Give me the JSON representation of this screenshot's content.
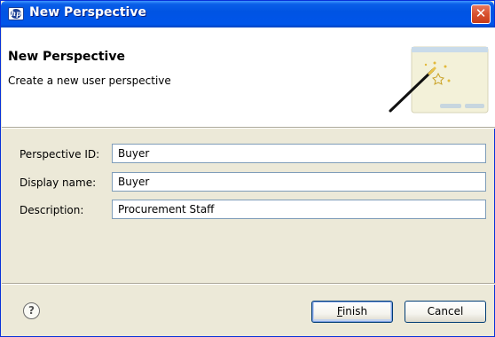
{
  "window": {
    "title": "New Perspective",
    "app_icon": "hp-logo-icon",
    "close_glyph": "✕"
  },
  "header": {
    "title": "New Perspective",
    "description": "Create a new user perspective",
    "graphic": "wizard-wand-icon"
  },
  "form": {
    "perspective_id": {
      "label": "Perspective ID:",
      "value": "Buyer"
    },
    "display_name": {
      "label": "Display name:",
      "value": "Buyer"
    },
    "description": {
      "label": "Description:",
      "value": "Procurement Staff"
    }
  },
  "footer": {
    "help_glyph": "?",
    "finish": {
      "mnemonic": "F",
      "rest": "inish"
    },
    "cancel_label": "Cancel"
  },
  "colors": {
    "titlebar": "#0054e3",
    "dialog_bg": "#ece9d8",
    "input_border": "#7f9db9"
  }
}
